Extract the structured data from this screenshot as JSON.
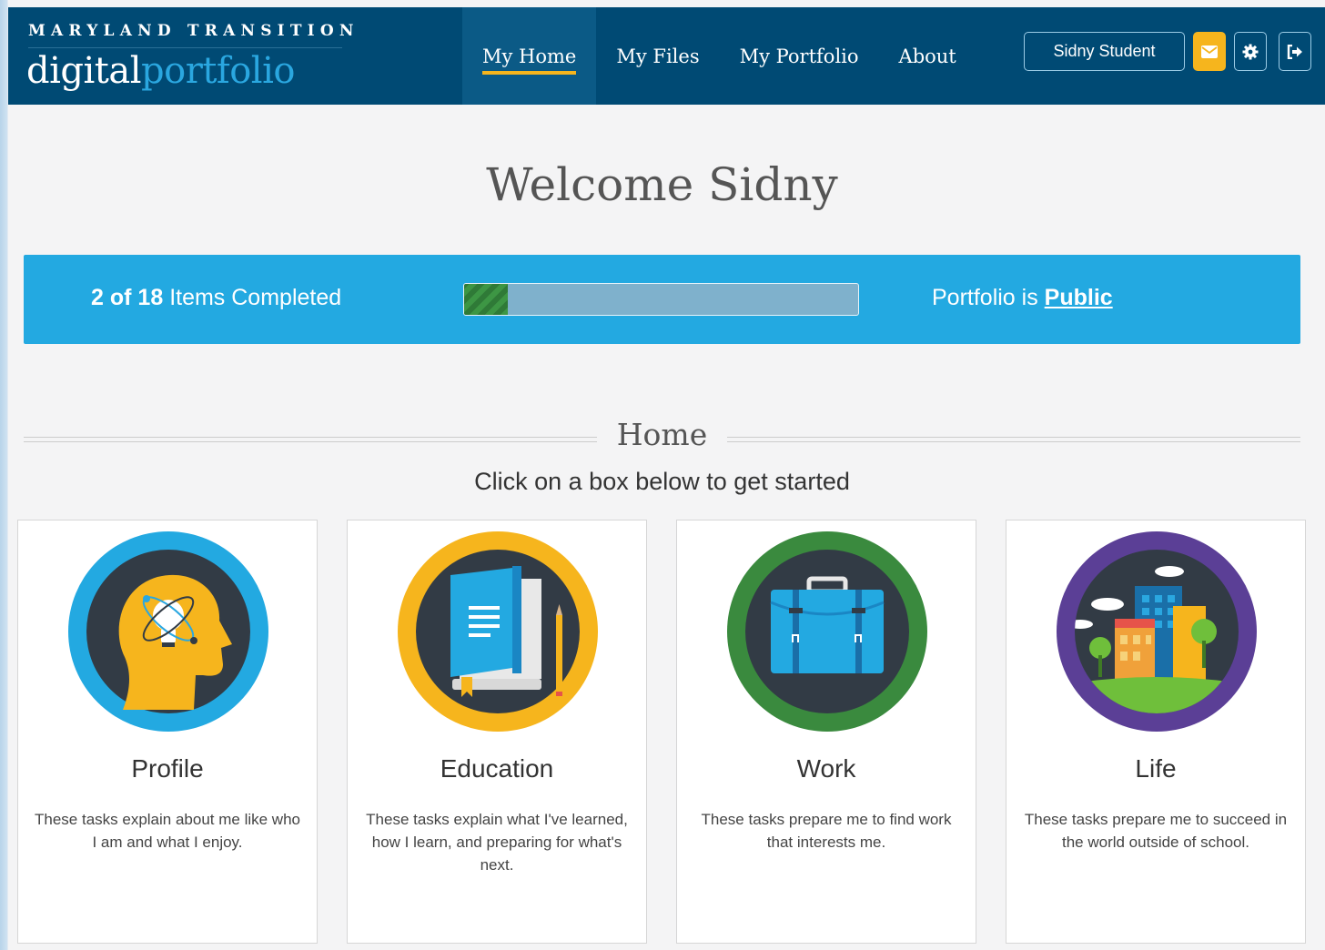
{
  "brand": {
    "top": "MARYLAND TRANSITION",
    "main_part1": "digital",
    "main_part2": "portfolio"
  },
  "nav": {
    "items": [
      {
        "label": "My Home",
        "active": true
      },
      {
        "label": "My Files",
        "active": false
      },
      {
        "label": "My Portfolio",
        "active": false
      },
      {
        "label": "About",
        "active": false
      }
    ],
    "user_button": "Sidny Student",
    "icons": [
      "envelope-icon",
      "gear-icon",
      "sign-out-icon"
    ]
  },
  "welcome": "Welcome Sidny",
  "progress": {
    "completed": "2",
    "of_word": "of",
    "total": "18",
    "label": "Items Completed",
    "fraction": 0.111,
    "visibility_prefix": "Portfolio is",
    "visibility_value": "Public"
  },
  "home": {
    "title": "Home",
    "subtitle": "Click on a box below to get started"
  },
  "cards": [
    {
      "title": "Profile",
      "desc": "These tasks explain about me like who I am and what I enjoy.",
      "icon": "head-lightbulb-icon",
      "ring": "#23a9e1"
    },
    {
      "title": "Education",
      "desc": "These tasks explain what I've learned, how I learn, and preparing for what's next.",
      "icon": "book-pencil-icon",
      "ring": "#f6b51d"
    },
    {
      "title": "Work",
      "desc": "These tasks prepare me to find work that interests me.",
      "icon": "briefcase-icon",
      "ring": "#3a8a3e"
    },
    {
      "title": "Life",
      "desc": "These tasks prepare me to succeed in the world outside of school.",
      "icon": "city-icon",
      "ring": "#5b3f96"
    }
  ],
  "colors": {
    "navbar": "#004a74",
    "accent": "#f6b51d",
    "progress_panel": "#23a9e1",
    "bar_fill": "#3d9644"
  }
}
